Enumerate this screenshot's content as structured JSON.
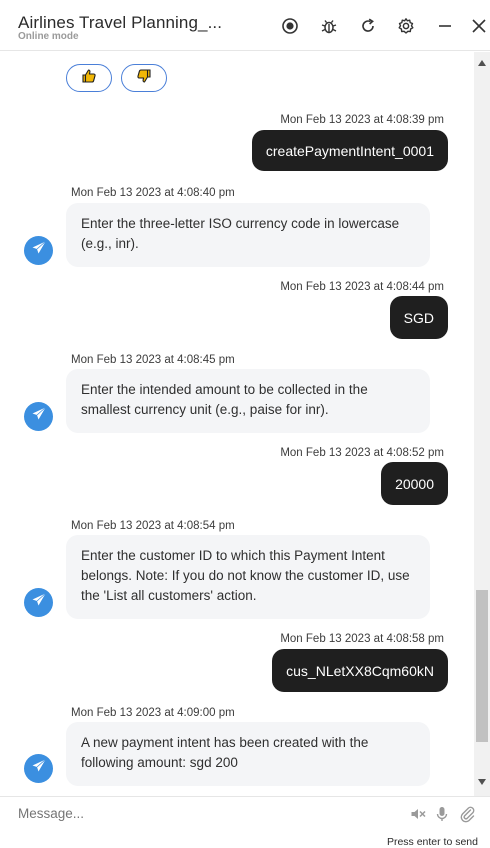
{
  "header": {
    "title": "Airlines Travel Planning_...",
    "subtitle": "Online mode",
    "icons": [
      "record-icon",
      "bug-icon",
      "refresh-icon",
      "settings-icon",
      "minimize-icon",
      "close-icon"
    ]
  },
  "feedback": {
    "like_icon": "thumbs-up-icon",
    "dislike_icon": "thumbs-down-icon"
  },
  "messages": [
    {
      "from": "user",
      "time": "Mon Feb 13 2023 at 4:08:39 pm",
      "text": "createPaymentIntent_0001"
    },
    {
      "from": "bot",
      "time": "Mon Feb 13 2023 at 4:08:40 pm",
      "text": "Enter the three-letter ISO currency code in lowercase (e.g., inr)."
    },
    {
      "from": "user",
      "time": "Mon Feb 13 2023 at 4:08:44 pm",
      "text": "SGD"
    },
    {
      "from": "bot",
      "time": "Mon Feb 13 2023 at 4:08:45 pm",
      "text": "Enter the intended amount to be collected in the smallest currency unit (e.g., paise for inr)."
    },
    {
      "from": "user",
      "time": "Mon Feb 13 2023 at 4:08:52 pm",
      "text": "20000"
    },
    {
      "from": "bot",
      "time": "Mon Feb 13 2023 at 4:08:54 pm",
      "text": "Enter the customer ID to which this Payment Intent belongs. Note: If you do not know the customer ID, use the 'List all customers' action."
    },
    {
      "from": "user",
      "time": "Mon Feb 13 2023 at 4:08:58 pm",
      "text": "cus_NLetXX8Cqm60kN"
    },
    {
      "from": "bot",
      "time": "Mon Feb 13 2023 at 4:09:00 pm",
      "text": "A new payment intent has been created with the following amount: sgd 200"
    }
  ],
  "composer": {
    "placeholder": "Message...",
    "hint": "Press enter to send",
    "icons": [
      "speaker-muted-icon",
      "microphone-icon",
      "attachment-icon"
    ]
  },
  "colors": {
    "user_bubble": "#1f1f1f",
    "bot_bubble": "#f4f5f7",
    "avatar": "#3b8fe0",
    "feedback_border": "#4a7fd8"
  }
}
